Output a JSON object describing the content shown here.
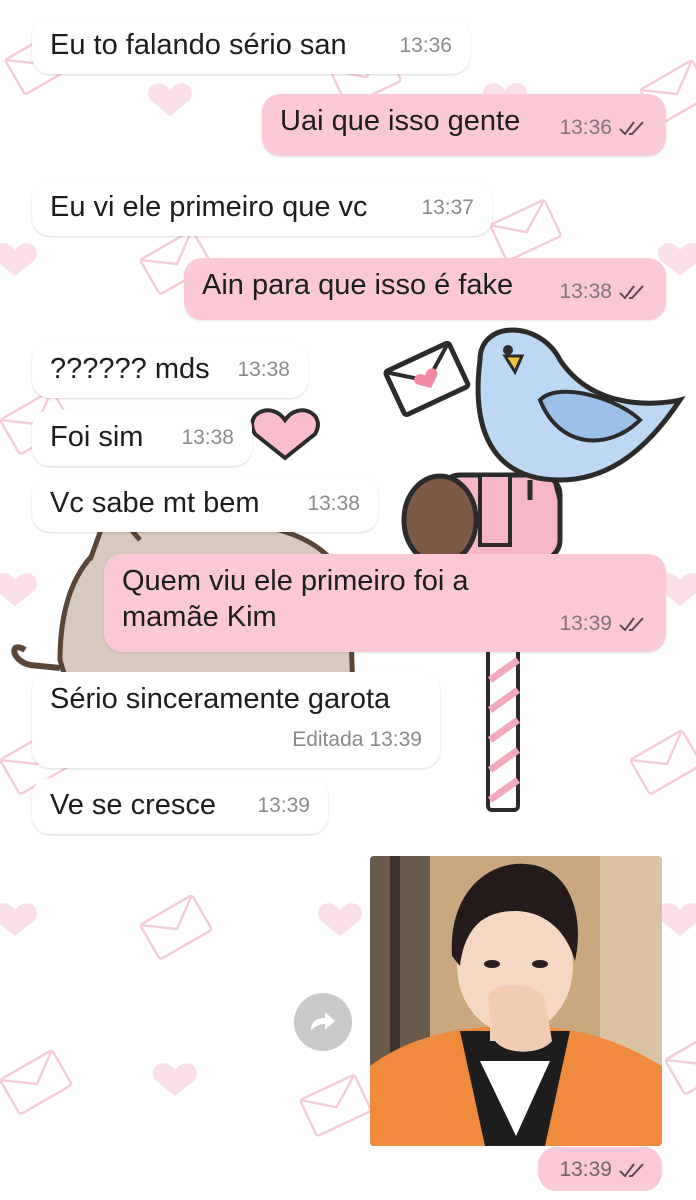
{
  "messages": [
    {
      "dir": "in",
      "text": "Eu to falando sério san",
      "time": "13:36"
    },
    {
      "dir": "out",
      "text": "Uai que isso gente",
      "time": "13:36"
    },
    {
      "dir": "in",
      "text": "Eu vi ele primeiro que vc",
      "time": "13:37"
    },
    {
      "dir": "out",
      "text": "Ain para que isso é fake",
      "time": "13:38"
    },
    {
      "dir": "in",
      "text": "?????? mds",
      "time": "13:38"
    },
    {
      "dir": "in",
      "text": "Foi sim",
      "time": "13:38"
    },
    {
      "dir": "in",
      "text": "Vc sabe mt bem",
      "time": "13:38"
    },
    {
      "dir": "out",
      "text": "Quem viu ele primeiro foi a mamãe Kim",
      "time": "13:39"
    },
    {
      "dir": "in",
      "text": "Sério sinceramente garota",
      "edited_label": "Editada",
      "time": "13:39"
    },
    {
      "dir": "in",
      "text": "Ve se cresce",
      "time": "13:39"
    }
  ],
  "photo_message": {
    "time": "13:39",
    "read_status": "double-check-icon"
  },
  "icons": {
    "forward": "forward-icon",
    "ticks": "double-check-icon"
  },
  "colors": {
    "outgoing_bubble": "#fbc9d5",
    "incoming_bubble": "#ffffff",
    "wallpaper_accent": "#f5c2cf"
  }
}
